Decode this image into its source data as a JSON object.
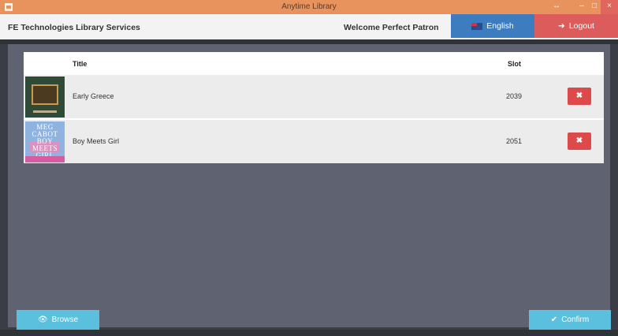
{
  "window": {
    "title": "Anytime Library",
    "controls": {
      "resize": "↔",
      "minimize": "–",
      "maximize": "□",
      "close": "×"
    }
  },
  "header": {
    "brand": "FE Technologies Library Services",
    "welcome": "Welcome Perfect Patron",
    "language_button": "English",
    "logout_button": "Logout",
    "logout_icon": "➜"
  },
  "table": {
    "columns": {
      "title": "Title",
      "slot": "Slot"
    },
    "rows": [
      {
        "title": "Early Greece",
        "slot": "2039",
        "remove": "✖"
      },
      {
        "title": "Boy Meets Girl",
        "slot": "2051",
        "remove": "✖"
      }
    ]
  },
  "covers": {
    "boy_meets_girl": "MEG CABOT BOY MEETS GIRL"
  },
  "footer": {
    "browse_button": "Browse",
    "browse_icon": "👁",
    "confirm_button": "Confirm",
    "confirm_icon": "✔"
  },
  "colors": {
    "titlebar": "#e8925e",
    "language": "#3c7cbf",
    "logout": "#dc5b5b",
    "delete": "#dc4a4a",
    "action": "#5bc0de",
    "panel": "#5f6270"
  }
}
